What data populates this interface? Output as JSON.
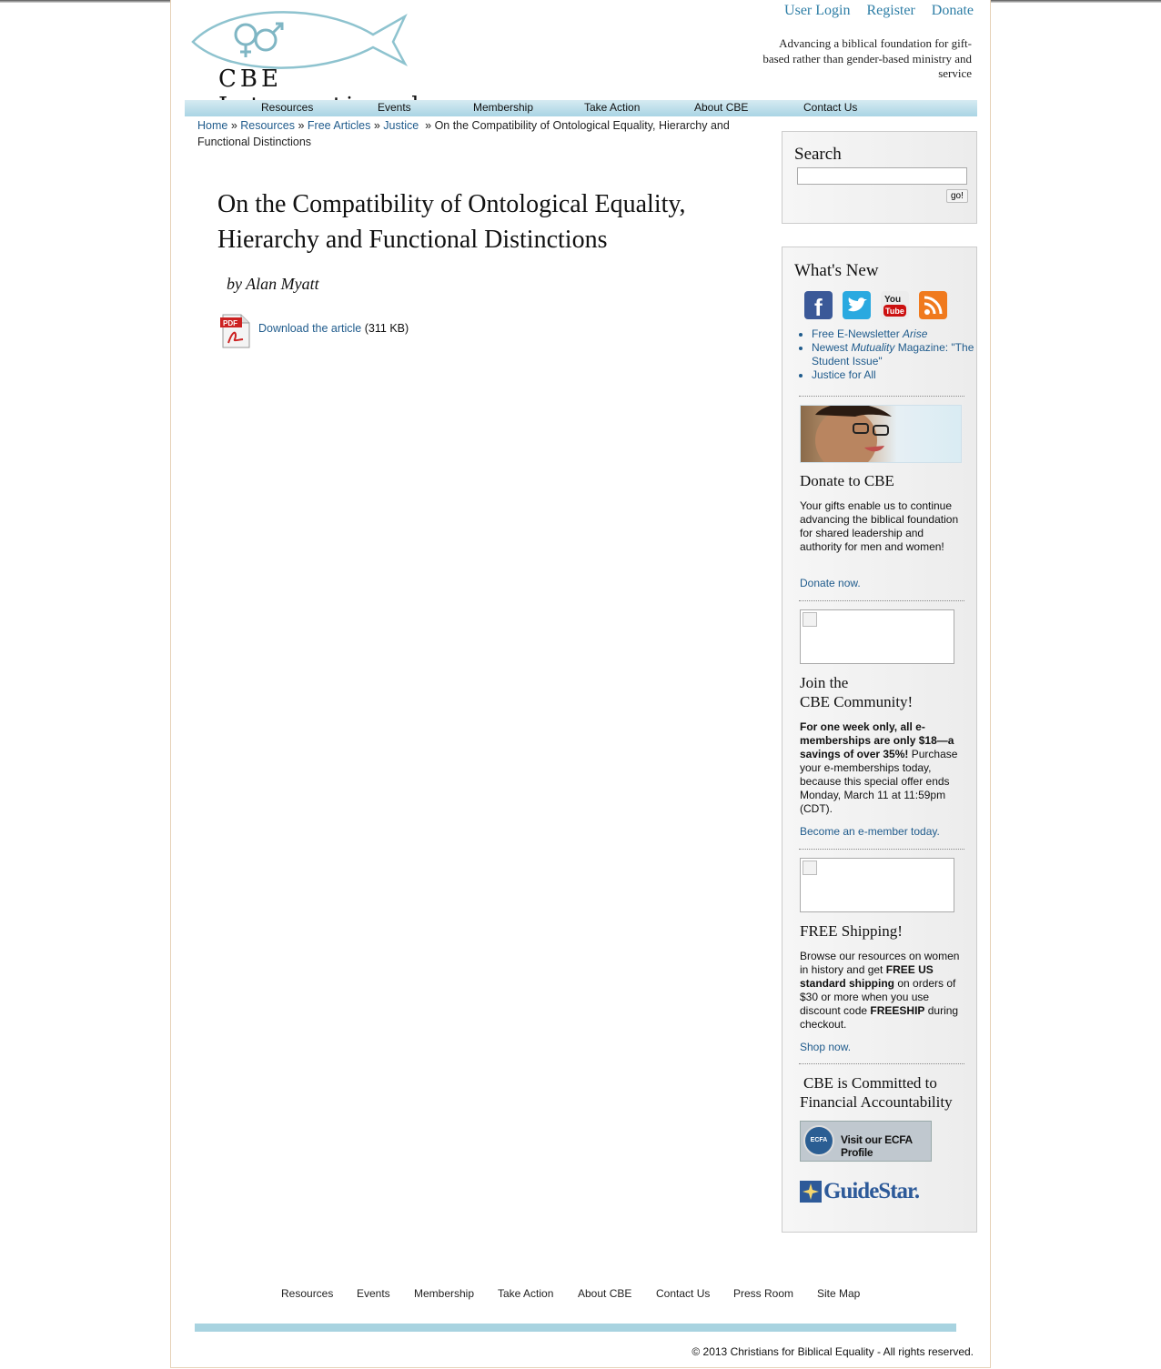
{
  "header": {
    "logo_text": "CBE International",
    "links": [
      "User Login",
      "Register",
      "Donate"
    ],
    "tagline": "Advancing a biblical foundation for gift-based rather than gender-based ministry and service"
  },
  "nav": [
    "Resources",
    "Events",
    "Membership",
    "Take Action",
    "About CBE",
    "Contact Us"
  ],
  "breadcrumb": {
    "items": [
      "Home",
      "Resources",
      "Free Articles",
      "Justice"
    ],
    "current": "On the Compatibility of Ontological Equality, Hierarchy and Functional Distinctions"
  },
  "article": {
    "title": "On the Compatibility of Ontological Equality, Hierarchy and Functional Distinctions",
    "byline": "by Alan Myatt",
    "download_label": "Download the article",
    "file_size": "(311 KB)"
  },
  "search": {
    "heading": "Search",
    "button": "go!"
  },
  "whats_new": {
    "heading": "What's New",
    "social": [
      "facebook-icon",
      "twitter-icon",
      "youtube-icon",
      "rss-icon"
    ],
    "links": [
      {
        "prefix": "Free E-Newsletter ",
        "em": "Arise",
        "suffix": ""
      },
      {
        "prefix": "Newest ",
        "em": "Mutuality",
        "suffix": " Magazine: \"The Student Issue\""
      },
      {
        "prefix": "Justice for All",
        "em": "",
        "suffix": ""
      }
    ]
  },
  "donate": {
    "heading": "Donate to CBE",
    "text": "Your gifts enable us to continue advancing the biblical foundation for shared leadership and authority for men and women!",
    "link": "Donate now."
  },
  "join": {
    "heading_line1": "Join the",
    "heading_line2": "CBE Community!",
    "bold": "For one week only, all e-memberships are only $18—a savings of over 35%!",
    "text": " Purchase your e-memberships today, because this special offer ends Monday, March 11 at 11:59pm (CDT).",
    "link": "Become an e-member today."
  },
  "shipping": {
    "heading": "FREE Shipping!",
    "text1": "Browse our resources on women in history and get ",
    "bold1": "FREE US standard shipping",
    "text2": " on orders of $30 or more when you use discount code ",
    "bold2": "FREESHIP",
    "text3": " during checkout.",
    "link": "Shop now."
  },
  "accountability": {
    "heading_line1": "CBE is Committed to",
    "heading_line2": "Financial Accountability",
    "ecfa_seal": "ECFA",
    "ecfa_label": "Visit our ECFA Profile",
    "guidestar": "GuideStar."
  },
  "footer": {
    "nav": [
      "Resources",
      "Events",
      "Membership",
      "Take Action",
      "About CBE",
      "Contact Us",
      "Press Room",
      "Site Map"
    ],
    "copyright": "© 2013 Christians for Biblical Equality - All rights reserved."
  }
}
